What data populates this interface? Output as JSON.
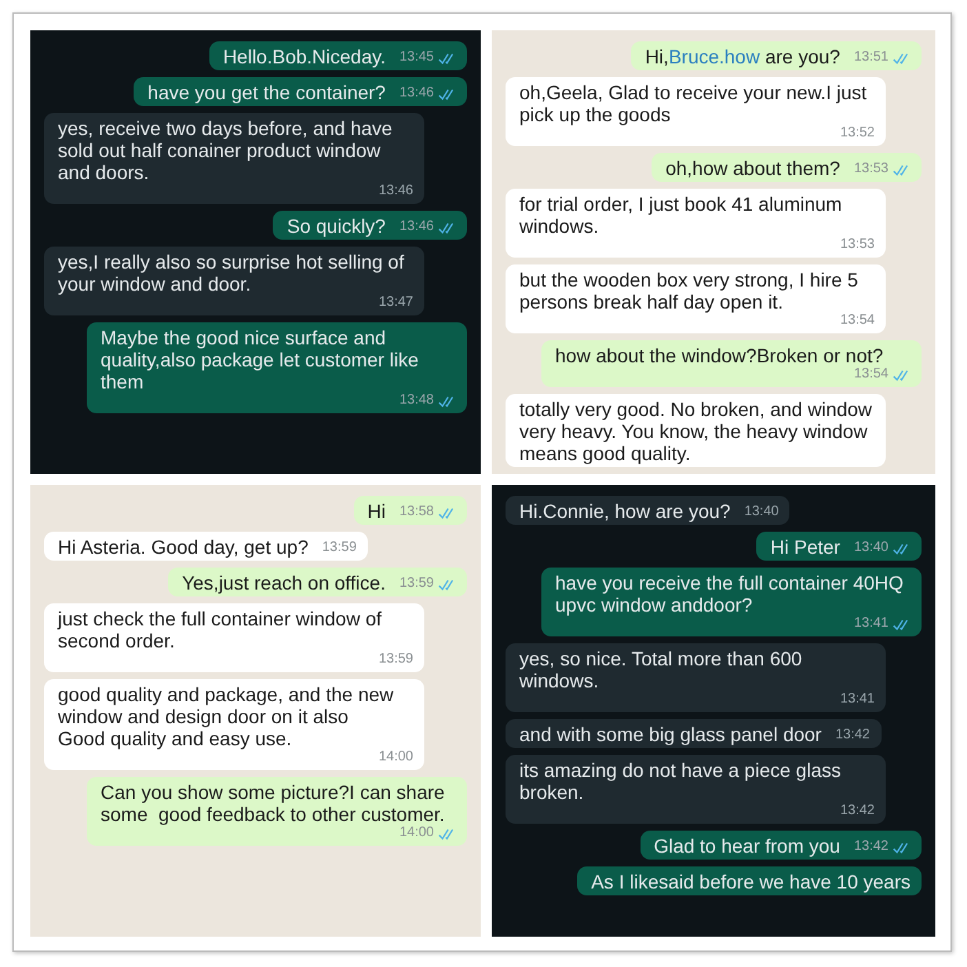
{
  "panels": [
    {
      "dark_mode": true,
      "messages": [
        {
          "kind": "sent",
          "text": "Hello.Bob.Niceday.",
          "time": "13:45",
          "read": true
        },
        {
          "kind": "sent",
          "text": "have you get the container?",
          "time": "13:46",
          "read": true
        },
        {
          "kind": "received",
          "text": "yes, receive two days before, and have sold out half conainer product window and doors.",
          "time": "13:46"
        },
        {
          "kind": "sent",
          "text": "So quickly?",
          "time": "13:46",
          "read": true
        },
        {
          "kind": "received",
          "text": "yes,I really also so surprise hot selling of your window and door.",
          "time": "13:47"
        },
        {
          "kind": "sent",
          "text": "Maybe the good nice surface and quality,also package let customer like them",
          "time": "13:48",
          "read": true
        }
      ]
    },
    {
      "dark_mode": false,
      "messages": [
        {
          "kind": "sent",
          "parts": [
            {
              "kind": "plain",
              "text": "Hi,"
            },
            {
              "kind": "link",
              "text": "Bruce.how"
            },
            {
              "kind": "plain",
              "text": " are you?"
            }
          ],
          "time": "13:51",
          "read": true
        },
        {
          "kind": "received",
          "text": "oh,Geela, Glad to receive your new.I just pick up the goods",
          "time": "13:52"
        },
        {
          "kind": "sent",
          "text": "oh,how about them?",
          "time": "13:53",
          "read": true
        },
        {
          "kind": "received",
          "text": "for trial order, I just book 41 aluminum windows.",
          "time": "13:53"
        },
        {
          "kind": "received",
          "text": "but the wooden box very strong, I hire 5 persons break half day open it.",
          "time": "13:54"
        },
        {
          "kind": "sent",
          "text": "how about the window?Broken or not?",
          "time": "13:54",
          "read": true
        },
        {
          "kind": "received",
          "text": "totally very good. No broken, and window very heavy. You know, the heavy window means good quality."
        }
      ]
    },
    {
      "dark_mode": false,
      "messages": [
        {
          "kind": "sent",
          "text": "Hi",
          "time": "13:58",
          "read": true
        },
        {
          "kind": "received",
          "text": "Hi Asteria. Good day, get up?",
          "time": "13:59"
        },
        {
          "kind": "sent",
          "text": "Yes,just reach on office.",
          "time": "13:59",
          "read": true
        },
        {
          "kind": "received",
          "text": "just check the full container window of second order.",
          "time": "13:59"
        },
        {
          "kind": "received",
          "text": "good quality and package, and the new window and design door on it also\nGood quality and easy use.",
          "time": "14:00"
        },
        {
          "kind": "sent",
          "text": "Can you show some picture?I can share some  good feedback to other customer.",
          "time": "14:00",
          "read": true
        }
      ]
    },
    {
      "dark_mode": true,
      "messages": [
        {
          "kind": "received",
          "text": "Hi.Connie, how are you?",
          "time": "13:40"
        },
        {
          "kind": "sent",
          "text": "Hi Peter",
          "time": "13:40",
          "read": true
        },
        {
          "kind": "sent",
          "text": "have you receive the full container 40HQ upvc window anddoor?",
          "time": "13:41",
          "read": true
        },
        {
          "kind": "received",
          "text": "yes, so nice. Total more than 600 windows.",
          "time": "13:41"
        },
        {
          "kind": "received",
          "text": "and with some big glass panel door",
          "time": "13:42"
        },
        {
          "kind": "received",
          "text": "its amazing do not have a piece glass broken.",
          "time": "13:42"
        },
        {
          "kind": "sent",
          "text": "Glad to hear from you",
          "time": "13:42",
          "read": true
        },
        {
          "kind": "sent",
          "text": "As I likesaid before we have 10 years"
        }
      ]
    }
  ]
}
